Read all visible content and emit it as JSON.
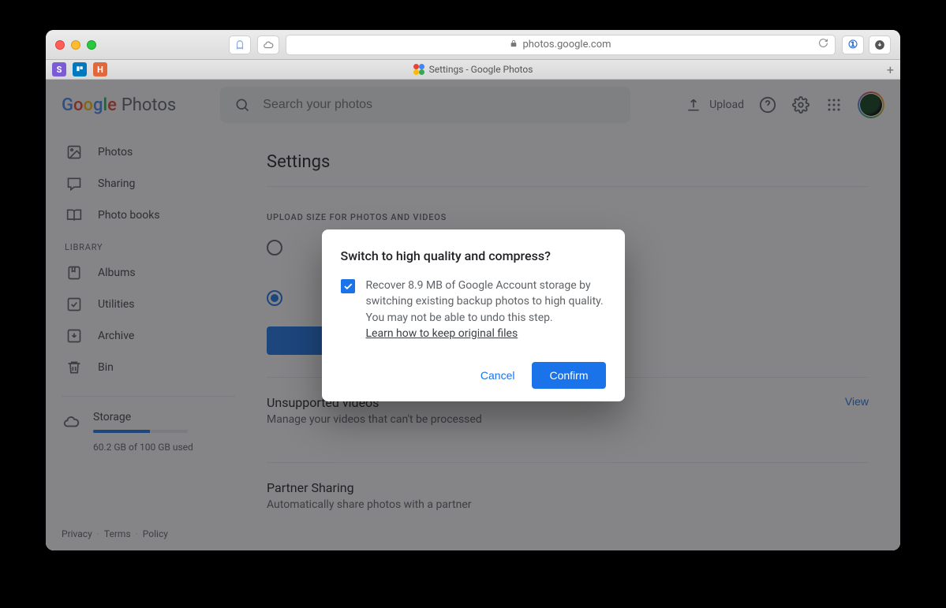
{
  "browser": {
    "url": "photos.google.com",
    "tab_title": "Settings - Google Photos"
  },
  "header": {
    "logo_text": "Photos",
    "search_placeholder": "Search your photos",
    "upload_label": "Upload"
  },
  "sidebar": {
    "items": [
      {
        "label": "Photos"
      },
      {
        "label": "Sharing"
      },
      {
        "label": "Photo books"
      }
    ],
    "library_label": "LIBRARY",
    "library_items": [
      {
        "label": "Albums"
      },
      {
        "label": "Utilities"
      },
      {
        "label": "Archive"
      },
      {
        "label": "Bin"
      }
    ],
    "storage": {
      "title": "Storage",
      "used_text": "60.2 GB of 100 GB used",
      "percent": 60
    }
  },
  "footer": {
    "privacy": "Privacy",
    "terms": "Terms",
    "policy": "Policy"
  },
  "main": {
    "page_title": "Settings",
    "upload_section_label": "UPLOAD SIZE FOR PHOTOS AND VIDEOS",
    "rows": [
      {
        "title": "Unsupported videos",
        "subtitle": "Manage your videos that can't be processed",
        "action": "View"
      },
      {
        "title": "Partner Sharing",
        "subtitle": "Automatically share photos with a partner",
        "action": ""
      }
    ]
  },
  "dialog": {
    "title": "Switch to high quality and compress?",
    "body": "Recover 8.9 MB of Google Account storage by switching existing backup photos to high quality. You may not be able to undo this step.",
    "learn_link": "Learn how to keep original files",
    "cancel": "Cancel",
    "confirm": "Confirm"
  }
}
